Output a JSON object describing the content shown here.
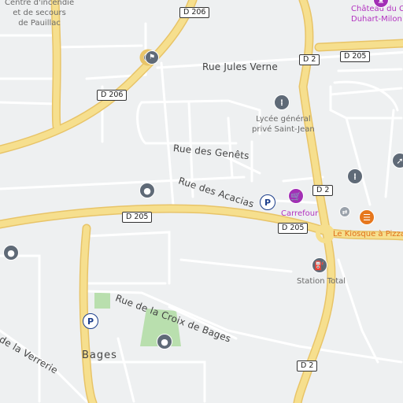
{
  "colors": {
    "background": "#eef0f1",
    "major_road": "#f6df8e",
    "major_road_casing": "#e8c468",
    "minor_road": "#ffffff",
    "green_area": "#b9dfae",
    "poi_grey": "#5f6a77",
    "poi_purple": "#a22fb5",
    "poi_orange": "#e6771d",
    "parking_blue": "#1d3f8c"
  },
  "roads": {
    "d206_top": "D 206",
    "d206_left": "D 206",
    "d2_north": "D 2",
    "d2_mid": "D 2",
    "d2_south": "D 2",
    "d205_ne": "D 205",
    "d205_center": "D 205",
    "d205_east": "D 205"
  },
  "streets": {
    "jules_verne": "Rue Jules Verne",
    "genets": "Rue des Genêts",
    "acacias": "Rue des Acacias",
    "croix_de_bages": "Rue de la Croix de Bages",
    "verrerie": "de la Verrerie"
  },
  "places": {
    "centre_incendie": [
      "Centre d'incendie",
      "et de secours",
      "de Pauillac"
    ],
    "chateau": [
      "Château du Château",
      "Duhart-Milon"
    ],
    "lycee": [
      "Lycée général",
      "privé Saint-Jean"
    ],
    "carrefour": "Carrefour",
    "kiosque": "Le Kiosque à Pizzas",
    "station": "Station Total",
    "town": "Bages"
  },
  "icons": {
    "parking": "P",
    "school": "school-icon",
    "shopping": "shopping-cart-icon",
    "fuel": "fuel-pump-icon",
    "restaurant": "restaurant-icon",
    "place": "place-pin-icon",
    "museum": "museum-icon",
    "roundabout": "roundabout-icon",
    "landmark": "landmark-icon",
    "arrows": "traffic-arrows-icon"
  }
}
